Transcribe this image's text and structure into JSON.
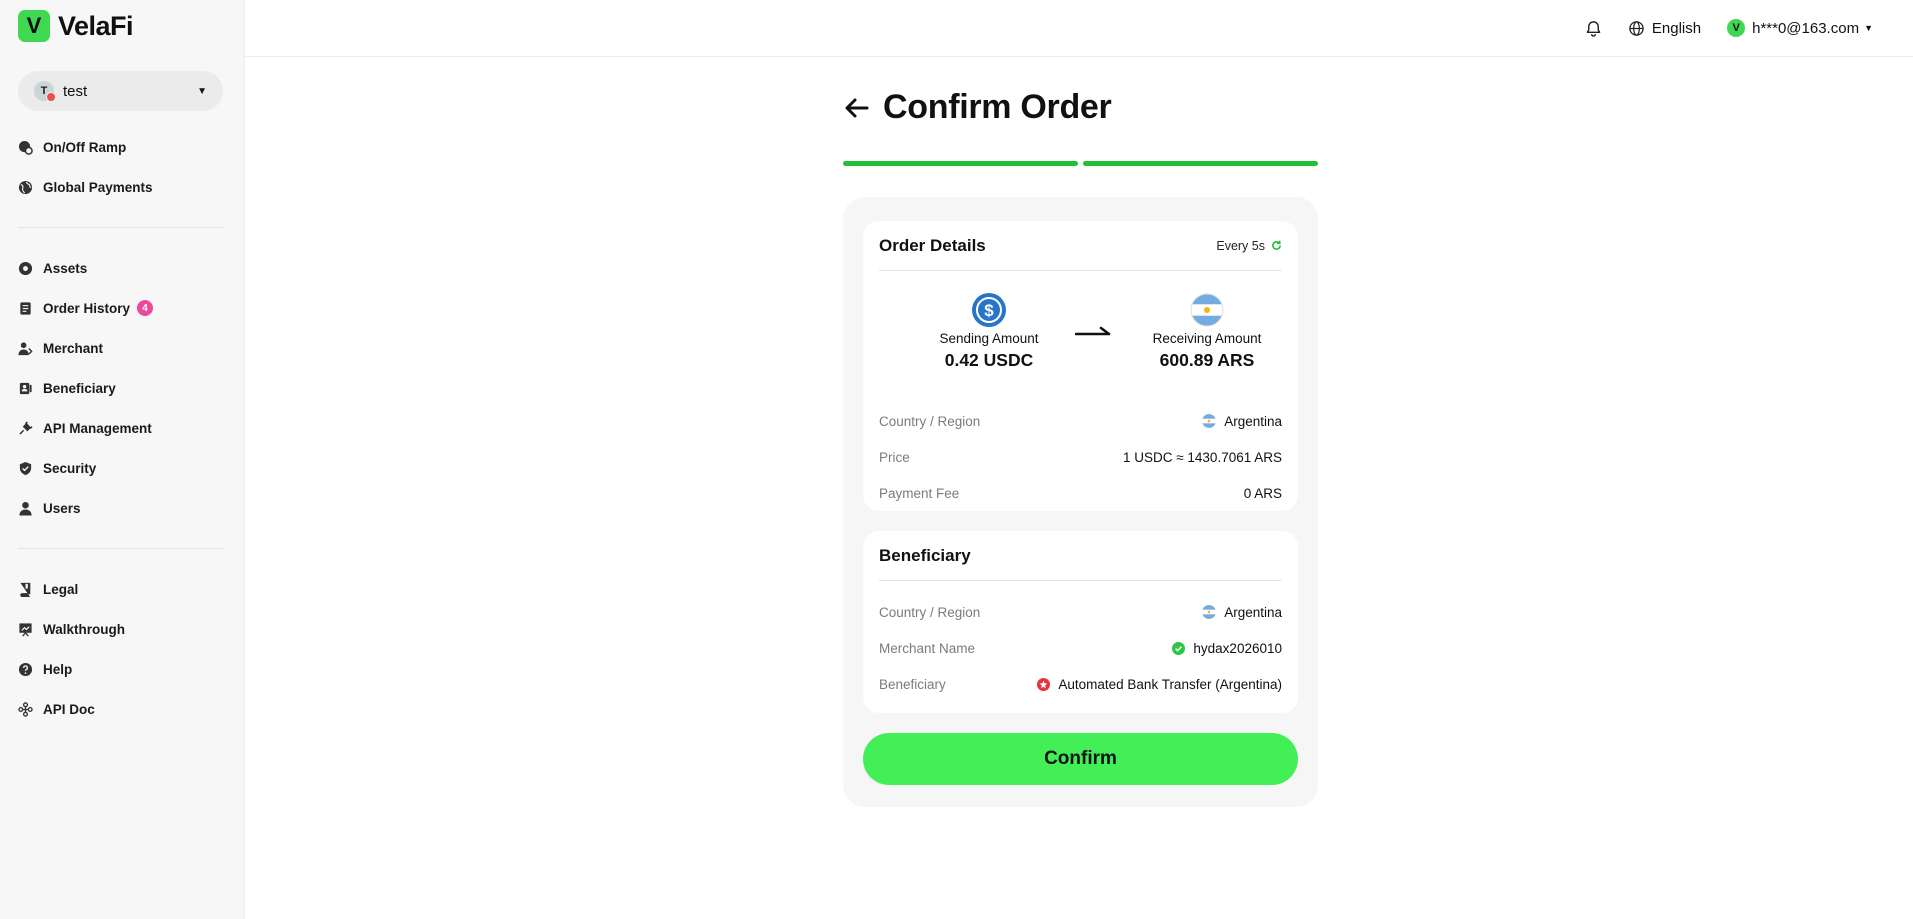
{
  "app": {
    "logo_letter": "V",
    "name": "VelaFi",
    "brand_color": "#3fd951"
  },
  "workspace": {
    "avatar_letter": "T",
    "name": "test"
  },
  "sidebar": {
    "group1": [
      {
        "label": "On/Off Ramp",
        "icon": "ramp-icon"
      },
      {
        "label": "Global Payments",
        "icon": "globe-icon"
      }
    ],
    "group2": [
      {
        "label": "Assets",
        "icon": "assets-icon"
      },
      {
        "label": "Order History",
        "icon": "receipt-icon",
        "badge": "4"
      },
      {
        "label": "Merchant",
        "icon": "merchant-icon"
      },
      {
        "label": "Beneficiary",
        "icon": "bank-icon"
      },
      {
        "label": "API Management",
        "icon": "plug-icon"
      },
      {
        "label": "Security",
        "icon": "shield-icon"
      },
      {
        "label": "Users",
        "icon": "user-icon"
      }
    ],
    "group3": [
      {
        "label": "Legal",
        "icon": "book-icon"
      },
      {
        "label": "Walkthrough",
        "icon": "presentation-icon"
      },
      {
        "label": "Help",
        "icon": "help-icon"
      },
      {
        "label": "API Doc",
        "icon": "api-doc-icon"
      }
    ]
  },
  "header": {
    "language": "English",
    "account_letter": "V",
    "account_email": "h***0@163.com"
  },
  "page": {
    "title": "Confirm Order",
    "progress_steps_completed": 2,
    "progress_steps_total": 2
  },
  "order_details": {
    "title": "Order Details",
    "refresh_text": "Every 5s",
    "sending_label": "Sending Amount",
    "sending_value": "0.42 USDC",
    "receiving_label": "Receiving Amount",
    "receiving_value": "600.89 ARS",
    "rows": [
      {
        "label": "Country / Region",
        "value": "Argentina"
      },
      {
        "label": "Price",
        "value": "1 USDC ≈ 1430.7061 ARS"
      },
      {
        "label": "Payment Fee",
        "value": "0 ARS"
      }
    ]
  },
  "beneficiary": {
    "title": "Beneficiary",
    "rows": [
      {
        "label": "Country / Region",
        "value": "Argentina"
      },
      {
        "label": "Merchant Name",
        "value": "hydax2026010"
      },
      {
        "label": "Beneficiary",
        "value": "Automated Bank Transfer (Argentina)"
      }
    ]
  },
  "actions": {
    "confirm_label": "Confirm"
  },
  "colors": {
    "accent_green": "#43ef57",
    "progress_green": "#1fbf36",
    "badge_pink": "#e94b9a",
    "usdc_blue": "#2775ca"
  }
}
